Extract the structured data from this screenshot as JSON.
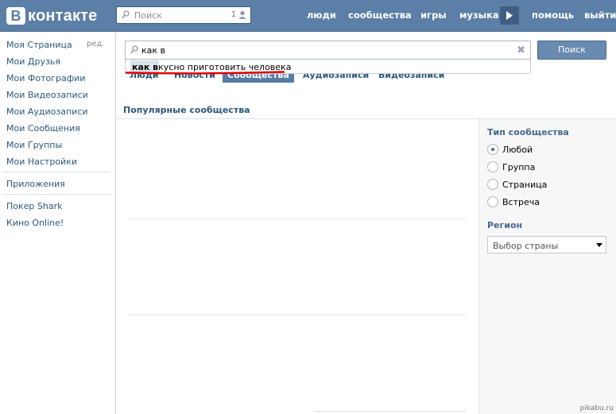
{
  "header": {
    "logo_letter": "В",
    "logo_text": "контакте",
    "search_placeholder": "Поиск",
    "search_count": "1",
    "nav": [
      "люди",
      "сообщества",
      "игры",
      "музыка",
      "помощь",
      "выйти"
    ]
  },
  "sidebar": {
    "items": [
      "Моя Страница",
      "Мои Друзья",
      "Мои Фотографии",
      "Мои Видеозаписи",
      "Мои Аудиозаписи",
      "Мои Сообщения",
      "Мои Группы",
      "Мои Настройки"
    ],
    "edit_label": "ред.",
    "apps_label": "Приложения",
    "apps": [
      "Покер Shark",
      "Кино Online!"
    ]
  },
  "search": {
    "value": "как в",
    "button_label": "Поиск",
    "suggestion_bold": "как в",
    "suggestion_rest": "кусно приготовить человека"
  },
  "tabs": [
    "Люди",
    "Новости",
    "Сообщества",
    "Аудиозаписи",
    "Видеозаписи"
  ],
  "active_tab": "Сообщества",
  "main": {
    "section_title": "Популярные сообщества"
  },
  "filters": {
    "type_title": "Тип сообщества",
    "type_options": [
      "Любой",
      "Группа",
      "Страница",
      "Встреча"
    ],
    "type_selected": "Любой",
    "region_title": "Регион",
    "region_select": "Выбор страны"
  },
  "watermark": "pikabu.ru",
  "colors": {
    "header_bg": "#5b7fa6",
    "link": "#2b587a",
    "underline": "#e00000"
  }
}
